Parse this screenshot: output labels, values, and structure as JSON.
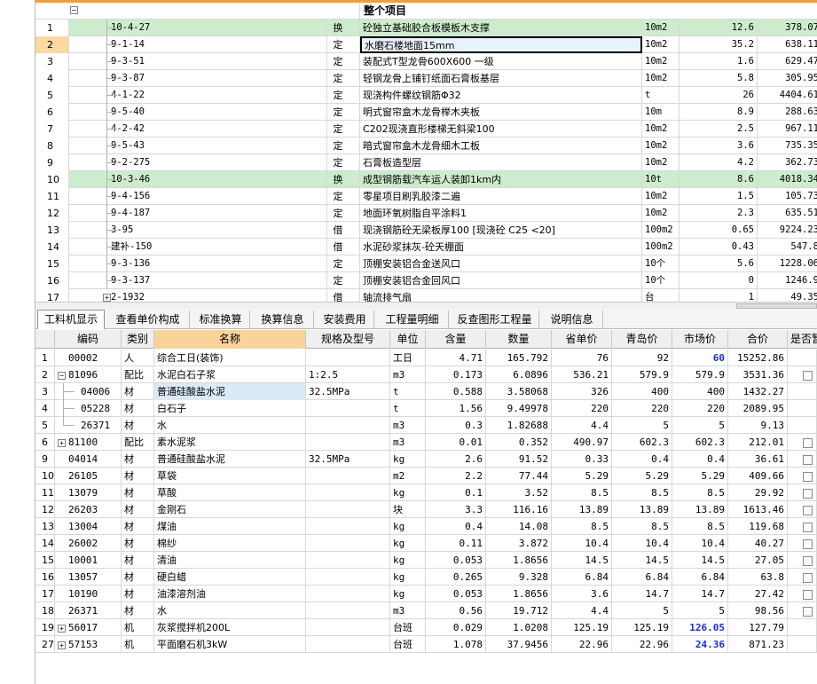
{
  "upper": {
    "header_title": "整个项目",
    "rows": [
      {
        "num": "1",
        "code": "10-4-27",
        "type": "换",
        "name": "砼独立基础胶合板模板木支撑",
        "unit": "10m2",
        "qty": "12.6",
        "price": "378.07",
        "green": true
      },
      {
        "num": "2",
        "code": "9-1-14",
        "type": "定",
        "name": "水磨石楼地面15mm",
        "unit": "10m2",
        "qty": "35.2",
        "price": "638.11",
        "selected": true
      },
      {
        "num": "3",
        "code": "9-3-51",
        "type": "定",
        "name": "装配式T型龙骨600X600 一级",
        "unit": "10m2",
        "qty": "1.6",
        "price": "629.47"
      },
      {
        "num": "4",
        "code": "9-3-87",
        "type": "定",
        "name": "轻钢龙骨上铺钉纸面石膏板基层",
        "unit": "10m2",
        "qty": "5.8",
        "price": "305.95"
      },
      {
        "num": "5",
        "code": "4-1-22",
        "type": "定",
        "name": "现浇构件螺纹钢筋Φ32",
        "unit": "t",
        "qty": "26",
        "price": "4404.61"
      },
      {
        "num": "6",
        "code": "9-5-40",
        "type": "定",
        "name": "明式窗帘盒木龙骨榉木夹板",
        "unit": "10m",
        "qty": "8.9",
        "price": "288.63"
      },
      {
        "num": "7",
        "code": "4-2-42",
        "type": "定",
        "name": "C202现浇直形楼梯无斜梁100",
        "unit": "10m2",
        "qty": "2.5",
        "price": "967.11"
      },
      {
        "num": "8",
        "code": "9-5-43",
        "type": "定",
        "name": "暗式窗帘盒木龙骨细木工板",
        "unit": "10m2",
        "qty": "3.6",
        "price": "735.35"
      },
      {
        "num": "9",
        "code": "9-2-275",
        "type": "定",
        "name": "石膏板造型层",
        "unit": "10m2",
        "qty": "4.2",
        "price": "362.73"
      },
      {
        "num": "10",
        "code": "10-3-46",
        "type": "换",
        "name": "成型钢筋载汽车运人装卸1km内",
        "unit": "10t",
        "qty": "8.6",
        "price": "4018.34",
        "green": true
      },
      {
        "num": "11",
        "code": "9-4-156",
        "type": "定",
        "name": "零星项目刷乳胶漆二遍",
        "unit": "10m2",
        "qty": "1.5",
        "price": "105.73"
      },
      {
        "num": "12",
        "code": "9-4-187",
        "type": "定",
        "name": "地面环氧树脂自平涂料1",
        "unit": "10m2",
        "qty": "2.3",
        "price": "635.51"
      },
      {
        "num": "13",
        "code": "3-95",
        "type": "借",
        "name": "现浇钢筋砼无梁板厚100 [现浇砼 C25 <20]",
        "unit": "100m2",
        "qty": "0.65",
        "price": "9224.23"
      },
      {
        "num": "14",
        "code": "建补-150",
        "type": "借",
        "name": "水泥砂浆抹灰-砼天棚面",
        "unit": "100m2",
        "qty": "0.43",
        "price": "547.8"
      },
      {
        "num": "15",
        "code": "9-3-136",
        "type": "定",
        "name": "顶棚安装铝合金送风口",
        "unit": "10个",
        "qty": "5.6",
        "price": "1228.06"
      },
      {
        "num": "16",
        "code": "9-3-137",
        "type": "定",
        "name": "顶棚安装铝合金回风口",
        "unit": "10个",
        "qty": "0",
        "price": "1246.9"
      },
      {
        "num": "17",
        "code": "2-1932",
        "type": "借",
        "name": "轴流排气扇",
        "unit": "台",
        "qty": "1",
        "price": "49.35",
        "expandable": true
      }
    ]
  },
  "tabs": [
    "工料机显示",
    "查看单价构成",
    "标准换算",
    "换算信息",
    "安装费用",
    "工程量明细",
    "反查图形工程量",
    "说明信息"
  ],
  "lower": {
    "headers": {
      "num": "",
      "code": "编码",
      "cat": "类别",
      "name": "名称",
      "spec": "规格及型号",
      "unit": "单位",
      "qty": "含量",
      "amt": "数量",
      "prov": "省单价",
      "qd": "青岛价",
      "mkt": "市场价",
      "tot": "合价",
      "chk": "是否暂"
    },
    "rows": [
      {
        "num": "1",
        "code": "00002",
        "cat": "人",
        "name": "综合工日(装饰)",
        "spec": "",
        "unit": "工日",
        "qty": "4.71",
        "amt": "165.792",
        "prov": "76",
        "qd": "92",
        "mkt": "60",
        "tot": "15252.86",
        "mkt_blue": true,
        "check": false
      },
      {
        "num": "2",
        "code": "81096",
        "cat": "配比",
        "name": "水泥白石子浆",
        "spec": "1:2.5",
        "unit": "m3",
        "qty": "0.173",
        "amt": "6.0896",
        "prov": "536.21",
        "qd": "579.9",
        "mkt": "579.9",
        "tot": "3531.36",
        "expand": "minus",
        "check": true
      },
      {
        "num": "3",
        "code": "04006",
        "cat": "材",
        "name": "普通硅酸盐水泥",
        "spec": "32.5MPa",
        "unit": "t",
        "qty": "0.588",
        "amt": "3.58068",
        "prov": "326",
        "qd": "400",
        "mkt": "400",
        "tot": "1432.27",
        "child": true,
        "name_sel": true,
        "check": false
      },
      {
        "num": "4",
        "code": "05228",
        "cat": "材",
        "name": "白石子",
        "spec": "",
        "unit": "t",
        "qty": "1.56",
        "amt": "9.49978",
        "prov": "220",
        "qd": "220",
        "mkt": "220",
        "tot": "2089.95",
        "child": true,
        "check": false
      },
      {
        "num": "5",
        "code": "26371",
        "cat": "材",
        "name": "水",
        "spec": "",
        "unit": "m3",
        "qty": "0.3",
        "amt": "1.82688",
        "prov": "4.4",
        "qd": "5",
        "mkt": "5",
        "tot": "9.13",
        "child": true,
        "last_child": true,
        "check": false
      },
      {
        "num": "6",
        "code": "81100",
        "cat": "配比",
        "name": "素水泥浆",
        "spec": "",
        "unit": "m3",
        "qty": "0.01",
        "amt": "0.352",
        "prov": "490.97",
        "qd": "602.3",
        "mkt": "602.3",
        "tot": "212.01",
        "expand": "plus",
        "check": true
      },
      {
        "num": "9",
        "code": "04014",
        "cat": "材",
        "name": "普通硅酸盐水泥",
        "spec": "32.5MPa",
        "unit": "kg",
        "qty": "2.6",
        "amt": "91.52",
        "prov": "0.33",
        "qd": "0.4",
        "mkt": "0.4",
        "tot": "36.61",
        "check": true
      },
      {
        "num": "10",
        "code": "26105",
        "cat": "材",
        "name": "草袋",
        "spec": "",
        "unit": "m2",
        "qty": "2.2",
        "amt": "77.44",
        "prov": "5.29",
        "qd": "5.29",
        "mkt": "5.29",
        "tot": "409.66",
        "check": true
      },
      {
        "num": "11",
        "code": "13079",
        "cat": "材",
        "name": "草酸",
        "spec": "",
        "unit": "kg",
        "qty": "0.1",
        "amt": "3.52",
        "prov": "8.5",
        "qd": "8.5",
        "mkt": "8.5",
        "tot": "29.92",
        "check": true
      },
      {
        "num": "12",
        "code": "26203",
        "cat": "材",
        "name": "金刚石",
        "spec": "",
        "unit": "块",
        "qty": "3.3",
        "amt": "116.16",
        "prov": "13.89",
        "qd": "13.89",
        "mkt": "13.89",
        "tot": "1613.46",
        "check": true
      },
      {
        "num": "13",
        "code": "13004",
        "cat": "材",
        "name": "煤油",
        "spec": "",
        "unit": "kg",
        "qty": "0.4",
        "amt": "14.08",
        "prov": "8.5",
        "qd": "8.5",
        "mkt": "8.5",
        "tot": "119.68",
        "check": true
      },
      {
        "num": "14",
        "code": "26002",
        "cat": "材",
        "name": "棉纱",
        "spec": "",
        "unit": "kg",
        "qty": "0.11",
        "amt": "3.872",
        "prov": "10.4",
        "qd": "10.4",
        "mkt": "10.4",
        "tot": "40.27",
        "check": true
      },
      {
        "num": "15",
        "code": "10001",
        "cat": "材",
        "name": "清油",
        "spec": "",
        "unit": "kg",
        "qty": "0.053",
        "amt": "1.8656",
        "prov": "14.5",
        "qd": "14.5",
        "mkt": "14.5",
        "tot": "27.05",
        "check": true
      },
      {
        "num": "16",
        "code": "13057",
        "cat": "材",
        "name": "硬白蜡",
        "spec": "",
        "unit": "kg",
        "qty": "0.265",
        "amt": "9.328",
        "prov": "6.84",
        "qd": "6.84",
        "mkt": "6.84",
        "tot": "63.8",
        "check": true
      },
      {
        "num": "17",
        "code": "10190",
        "cat": "材",
        "name": "油漆溶剂油",
        "spec": "",
        "unit": "kg",
        "qty": "0.053",
        "amt": "1.8656",
        "prov": "3.6",
        "qd": "14.7",
        "mkt": "14.7",
        "tot": "27.42",
        "check": true
      },
      {
        "num": "18",
        "code": "26371",
        "cat": "材",
        "name": "水",
        "spec": "",
        "unit": "m3",
        "qty": "0.56",
        "amt": "19.712",
        "prov": "4.4",
        "qd": "5",
        "mkt": "5",
        "tot": "98.56",
        "check": true
      },
      {
        "num": "19",
        "code": "56017",
        "cat": "机",
        "name": "灰浆搅拌机200L",
        "spec": "",
        "unit": "台班",
        "qty": "0.029",
        "amt": "1.0208",
        "prov": "125.19",
        "qd": "125.19",
        "mkt": "126.05",
        "tot": "127.79",
        "expand": "plus",
        "mkt_blue": true,
        "check": false
      },
      {
        "num": "27",
        "code": "57153",
        "cat": "机",
        "name": "平面磨石机3kW",
        "spec": "",
        "unit": "台班",
        "qty": "1.078",
        "amt": "37.9456",
        "prov": "22.96",
        "qd": "22.96",
        "mkt": "24.36",
        "tot": "871.23",
        "expand": "plus",
        "mkt_blue": true,
        "check": false
      }
    ]
  },
  "colors": {
    "green_row": "#cdeccd",
    "selected_row_number": "#fbd9a0",
    "name_header": "#f9d39a",
    "blue_value": "#1a2fd6"
  }
}
